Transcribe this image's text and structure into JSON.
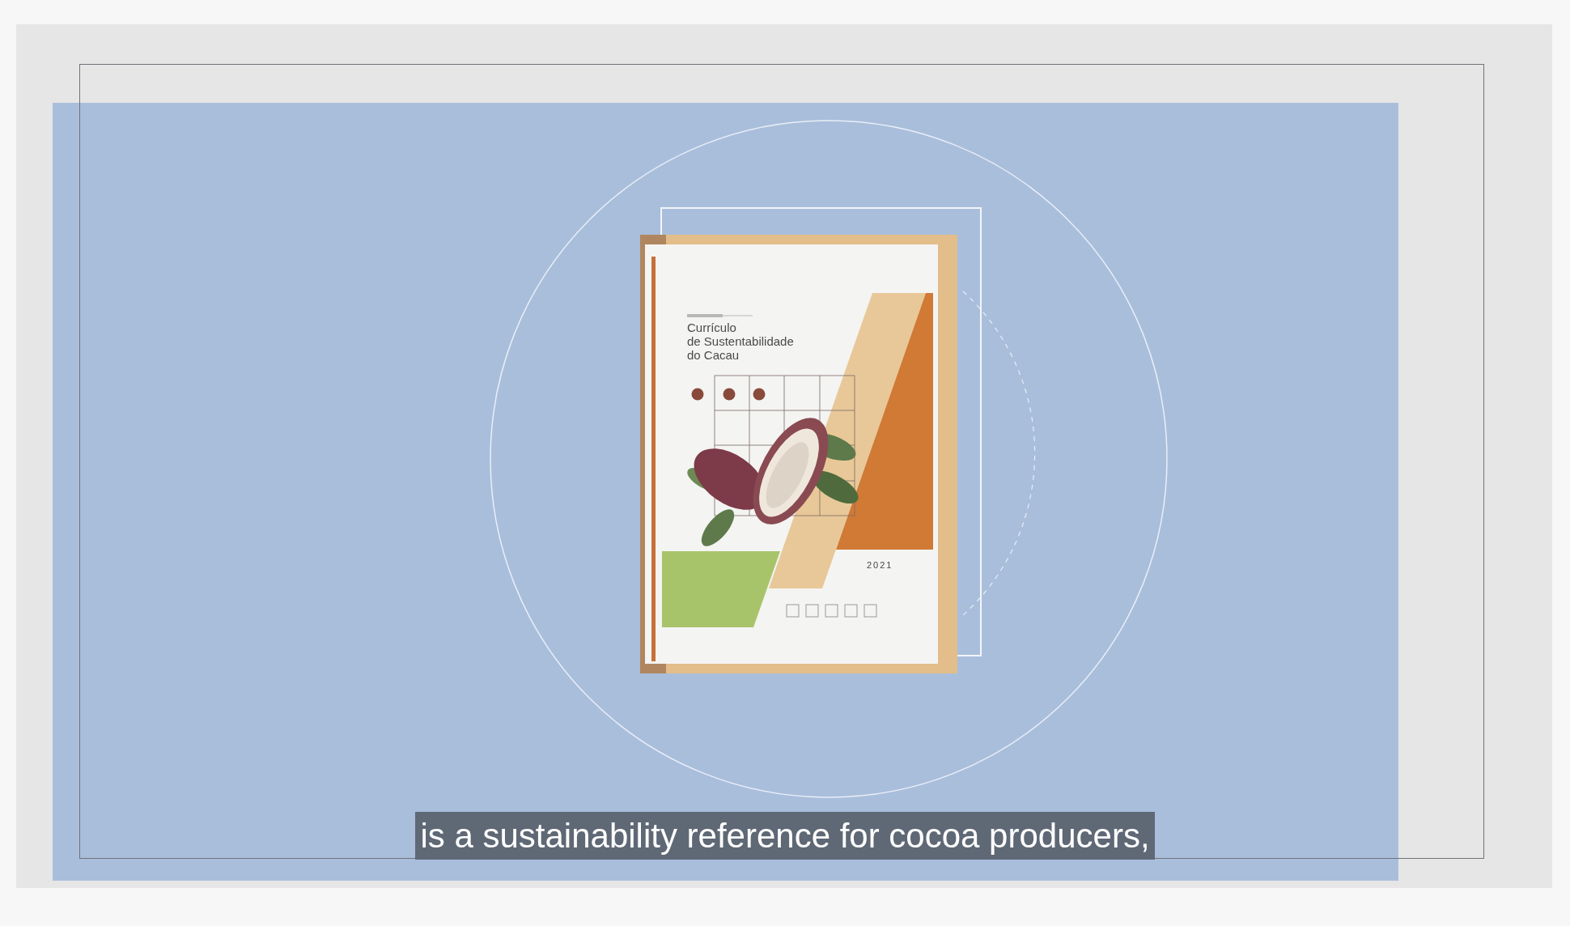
{
  "book_cover": {
    "title_lines": [
      "Currículo",
      "de Sustentabilidade",
      "do Cacau"
    ],
    "year": "2021"
  },
  "caption": "is a sustainability reference for cocoa producers,"
}
